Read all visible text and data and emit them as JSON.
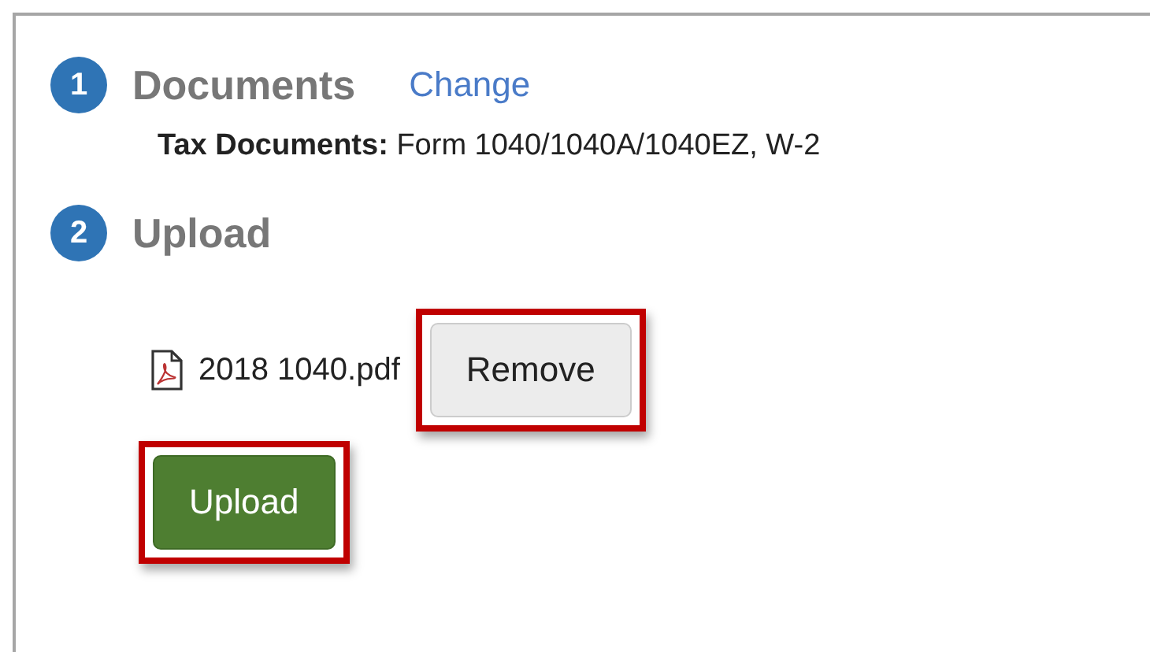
{
  "steps": [
    {
      "number": "1",
      "title": "Documents",
      "link": "Change",
      "detail_label": "Tax Documents:",
      "detail_value": "Form 1040/1040A/1040EZ, W-2"
    },
    {
      "number": "2",
      "title": "Upload"
    }
  ],
  "file": {
    "name": "2018 1040.pdf",
    "button": {
      "label": "Remove",
      "highlighted": true
    }
  },
  "upload_button": {
    "label": "Upload",
    "highlighted": true
  }
}
